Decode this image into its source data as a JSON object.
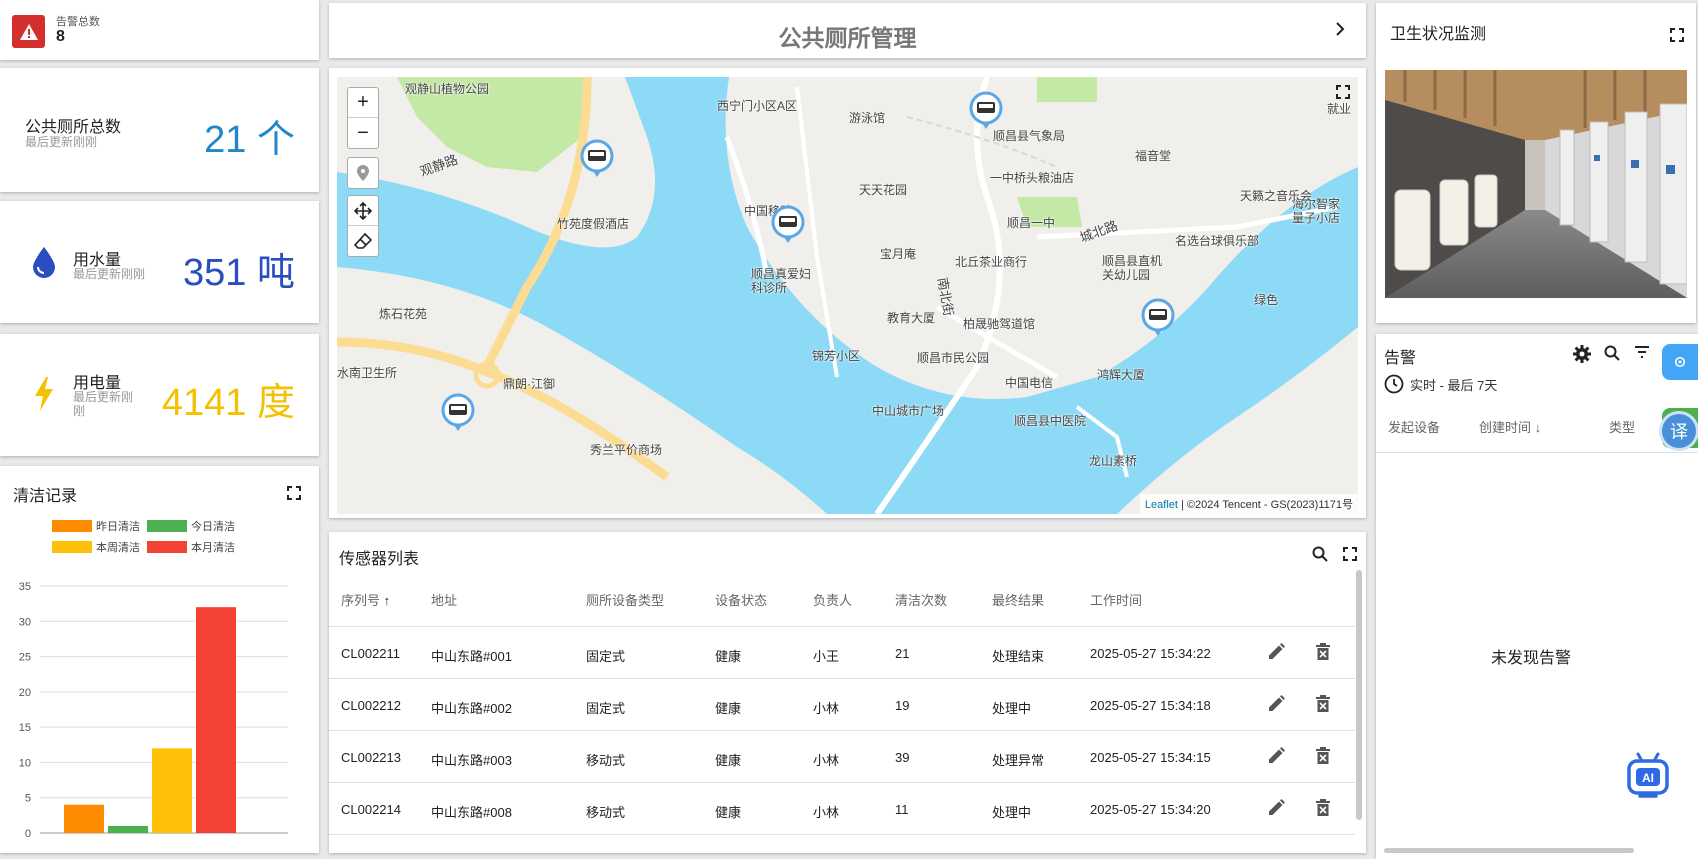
{
  "alert_summary": {
    "label": "告警总数",
    "value": "8"
  },
  "stats": {
    "total": {
      "title": "公共厕所总数",
      "sub": "最后更新刚刚",
      "value": "21 个"
    },
    "water": {
      "title": "用水量",
      "sub": "最后更新刚刚",
      "value": "351 吨"
    },
    "power": {
      "title": "用电量",
      "sub": "最后更新刚刚",
      "value": "4141 度"
    }
  },
  "header": {
    "title": "公共厕所管理"
  },
  "map": {
    "zoom_in": "+",
    "zoom_out": "−",
    "attribution_link": "Leaflet",
    "attribution_text": " | ©2024 Tencent - GS(2023)1171号",
    "labels": [
      "观静山植物公园",
      "观静路",
      "竹苑度假酒店",
      "西宁门小区A区",
      "游泳馆",
      "顺昌县气象局",
      "福音堂",
      "一中桥头粮油店",
      "天天花园",
      "中国移动",
      "顺昌真爱妇科诊所",
      "宝月庵",
      "北丘茶业商行",
      "海尔智家量子小店",
      "顺昌一中",
      "城北路",
      "名选台球俱乐部",
      "顺昌县直机关幼儿园",
      "天籁之音乐会",
      "炼石花苑",
      "水南卫生所",
      "鼎朗·江御",
      "教育大厦",
      "柏晟驰驾道馆",
      "锦芳小区",
      "顺昌市民公园",
      "中国电信",
      "鸿辉大厦",
      "中山城市广场",
      "顺昌县中医院",
      "秀兰平价商场",
      "龙山素桥",
      "南北街",
      "绿色",
      "就业"
    ]
  },
  "sensors": {
    "title": "传感器列表",
    "columns": [
      "序列号",
      "地址",
      "厕所设备类型",
      "设备状态",
      "负责人",
      "清洁次数",
      "最终结果",
      "工作时间"
    ],
    "rows": [
      [
        "CL002211",
        "中山东路#001",
        "固定式",
        "健康",
        "小王",
        "21",
        "处理结束",
        "2025-05-27 15:34:22"
      ],
      [
        "CL002212",
        "中山东路#002",
        "固定式",
        "健康",
        "小林",
        "19",
        "处理中",
        "2025-05-27 15:34:18"
      ],
      [
        "CL002213",
        "中山东路#003",
        "移动式",
        "健康",
        "小林",
        "39",
        "处理异常",
        "2025-05-27 15:34:15"
      ],
      [
        "CL002214",
        "中山东路#008",
        "移动式",
        "健康",
        "小林",
        "11",
        "处理中",
        "2025-05-27 15:34:20"
      ]
    ]
  },
  "hygiene": {
    "title": "卫生状况监测"
  },
  "alarms": {
    "title": "告警",
    "range": "实时 - 最后 7天",
    "columns": [
      "发起设备",
      "创建时间",
      "类型"
    ],
    "empty": "未发现告警",
    "translate_glyph": "译"
  },
  "cleaning": {
    "title": "清洁记录"
  },
  "chart_data": {
    "type": "bar",
    "title": "清洁记录",
    "series": [
      {
        "name": "昨日清洁",
        "values": [
          4
        ],
        "color": "#ff8c00"
      },
      {
        "name": "今日清洁",
        "values": [
          1
        ],
        "color": "#4caf50"
      },
      {
        "name": "本周清洁",
        "values": [
          12
        ],
        "color": "#ffc107"
      },
      {
        "name": "本月清洁",
        "values": [
          32
        ],
        "color": "#f44336"
      }
    ],
    "ylim": [
      0,
      35
    ],
    "yticks": [
      0,
      5,
      10,
      15,
      20,
      25,
      30,
      35
    ],
    "grid": true,
    "legend_position": "top"
  }
}
